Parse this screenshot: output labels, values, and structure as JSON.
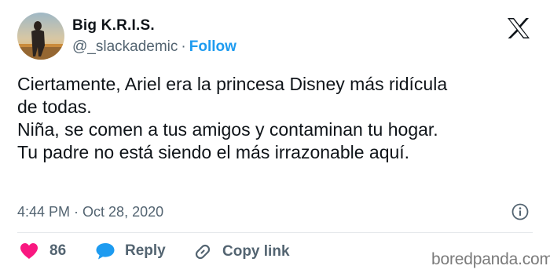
{
  "author": {
    "display_name": "Big K.R.I.S.",
    "handle": "@_slackademic",
    "separator": "·",
    "follow_label": "Follow"
  },
  "tweet": {
    "lines": [
      "Ciertamente, Ariel era la princesa Disney más ridícula",
      "de todas.",
      "Niña, se comen a tus amigos y contaminan tu hogar.",
      "Tu padre no está siendo el más irrazonable aquí."
    ],
    "time": "4:44 PM",
    "separator": "·",
    "date": "Oct 28, 2020"
  },
  "actions": {
    "likes_count": "86",
    "reply_label": "Reply",
    "copy_link_label": "Copy link"
  },
  "watermark": "boredpanda.com",
  "icons": {
    "platform": "x-logo-icon",
    "info": "info-icon",
    "like": "heart-icon",
    "reply": "speech-bubble-icon",
    "copy_link": "link-icon"
  },
  "colors": {
    "follow": "#1d9bf0",
    "heart": "#f91880",
    "reply_bubble": "#1d9bf0",
    "secondary_text": "#536471",
    "primary_text": "#0f1419"
  }
}
